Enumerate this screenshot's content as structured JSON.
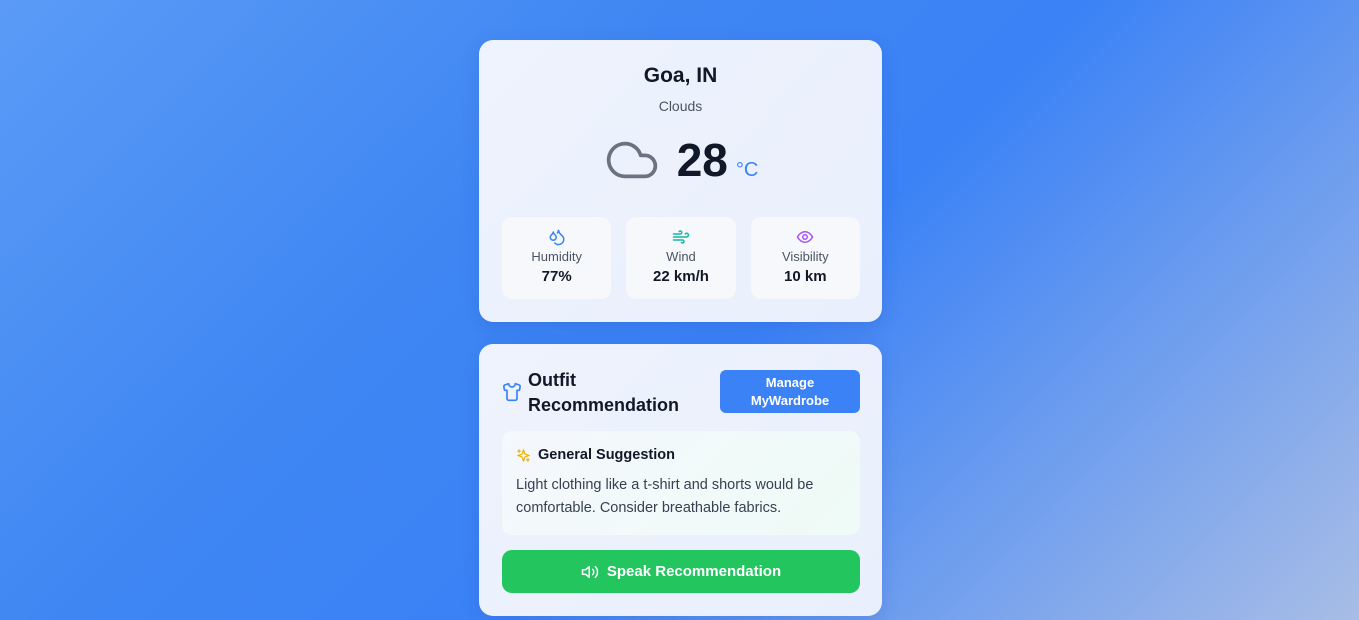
{
  "weather": {
    "city": "Goa, IN",
    "condition": "Clouds",
    "condition_icon": "cloud-icon",
    "temperature": "28",
    "unit": "°C",
    "stats": [
      {
        "icon": "droplets-icon",
        "label": "Humidity",
        "value": "77%",
        "color": "#3b82f6"
      },
      {
        "icon": "wind-icon",
        "label": "Wind",
        "value": "22 km/h",
        "color": "#14b8a6"
      },
      {
        "icon": "eye-icon",
        "label": "Visibility",
        "value": "10 km",
        "color": "#a855f7"
      }
    ]
  },
  "outfit": {
    "icon": "shirt-icon",
    "title": "Outfit Recommendation",
    "manage_button": "Manage MyWardrobe",
    "suggestion": {
      "icon": "sparkles-icon",
      "title": "General Suggestion",
      "text": "Light clothing like a t-shirt and shorts would be comfortable. Consider breathable fabrics."
    },
    "speak_button": "Speak Recommendation",
    "speak_icon": "speaker-icon"
  },
  "colors": {
    "accent": "#3b82f6",
    "success": "#22c55e"
  }
}
